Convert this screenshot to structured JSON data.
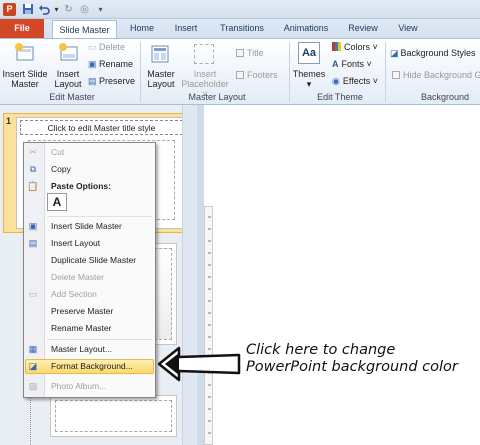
{
  "quick_access": {
    "icons": [
      "powerpoint-logo-icon",
      "save-icon",
      "undo-icon",
      "redo-icon",
      "repeat-icon",
      "customize-qat-icon"
    ]
  },
  "tabs": [
    {
      "label": "File"
    },
    {
      "label": "Slide Master"
    },
    {
      "label": "Home"
    },
    {
      "label": "Insert"
    },
    {
      "label": "Transitions"
    },
    {
      "label": "Animations"
    },
    {
      "label": "Review"
    },
    {
      "label": "View"
    }
  ],
  "ribbon": {
    "edit_master": {
      "label": "Edit Master",
      "insert_slide_master": [
        "Insert Slide",
        "Master"
      ],
      "insert_layout": [
        "Insert",
        "Layout"
      ],
      "delete": "Delete",
      "rename": "Rename",
      "preserve": "Preserve"
    },
    "master_layout": {
      "label": "Master Layout",
      "master_layout_btn": [
        "Master",
        "Layout"
      ],
      "insert_placeholder": [
        "Insert",
        "Placeholder ˅"
      ],
      "title": "Title",
      "footers": "Footers"
    },
    "edit_theme": {
      "label": "Edit Theme",
      "themes": "Themes",
      "themes_icon_text": "Aa",
      "colors": "Colors ˅",
      "fonts": "Fonts ˅",
      "effects": "Effects ˅"
    },
    "background": {
      "label": "Background",
      "background_styles": "Background Styles",
      "hide_background": "Hide Background G"
    }
  },
  "slide_panel": {
    "slide_number": "1",
    "thumb_title": "Click to edit Master title style"
  },
  "context_menu": {
    "items": [
      {
        "label": "Cut",
        "disabled": true
      },
      {
        "label": "Copy",
        "disabled": false
      },
      {
        "label": "Paste Options:",
        "disabled": false,
        "bold": true
      },
      {
        "label": "A",
        "disabled": false
      },
      {
        "label": "Insert Slide Master",
        "disabled": false
      },
      {
        "label": "Insert Layout",
        "disabled": false
      },
      {
        "label": "Duplicate Slide Master",
        "disabled": false
      },
      {
        "label": "Delete Master",
        "disabled": true
      },
      {
        "label": "Add Section",
        "disabled": true
      },
      {
        "label": "Preserve Master",
        "disabled": false
      },
      {
        "label": "Rename Master",
        "disabled": false
      },
      {
        "label": "Master Layout...",
        "disabled": false
      },
      {
        "label": "Format Background...",
        "disabled": false,
        "highlighted": true
      },
      {
        "label": "Photo Album...",
        "disabled": true
      }
    ]
  },
  "annotation": {
    "line1": "Click here to change",
    "line2": "PowerPoint background color"
  },
  "colors": {
    "file_tab": "#d24726",
    "highlight": "#fbd96c",
    "thumb_selected": "#fbe19b"
  }
}
